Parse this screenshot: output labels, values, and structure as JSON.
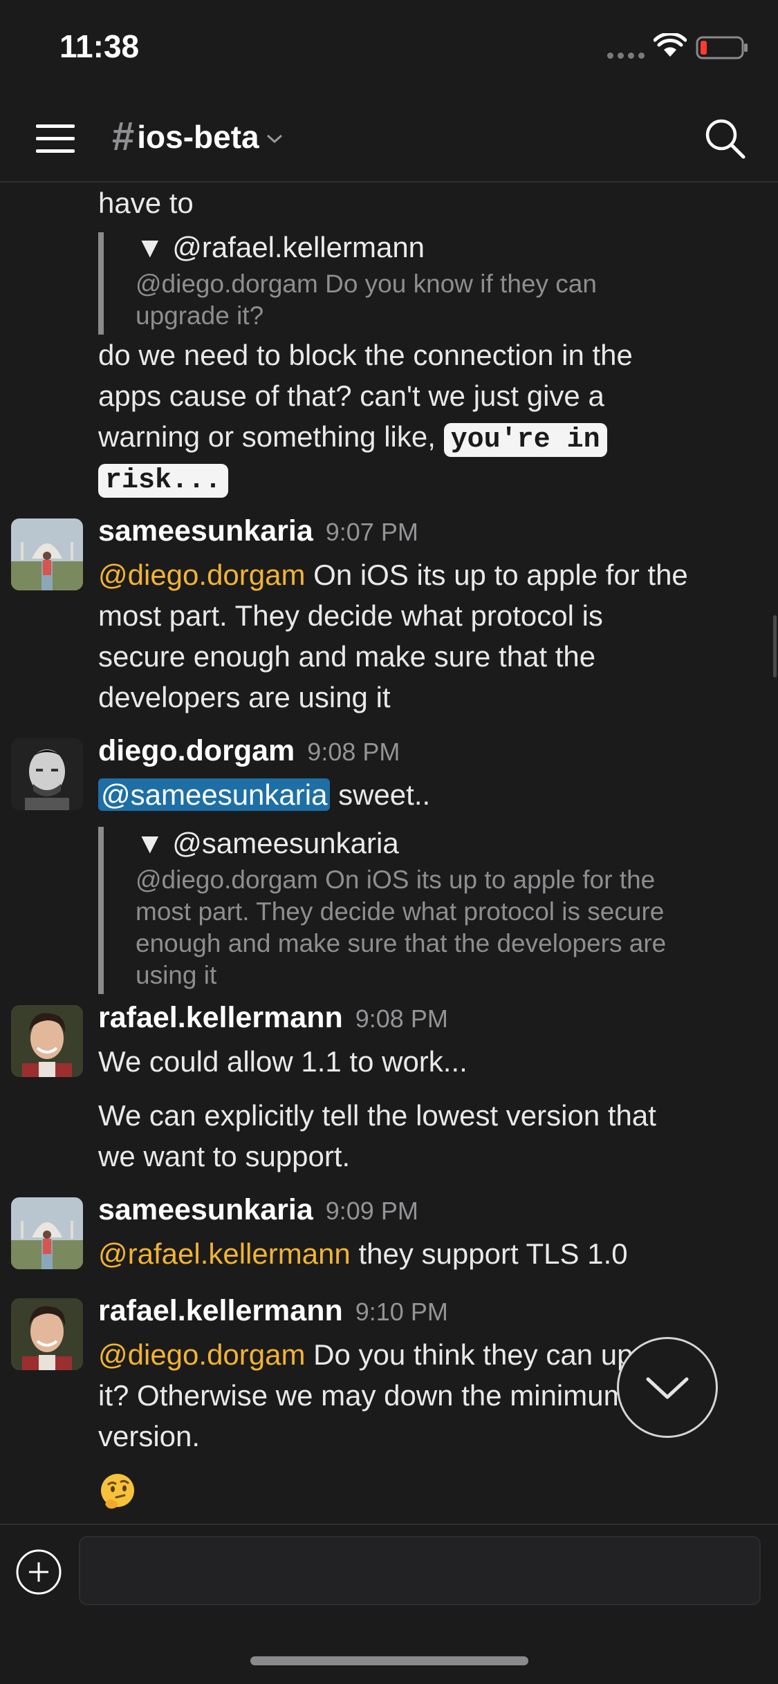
{
  "status_bar": {
    "time": "11:38"
  },
  "header": {
    "hash": "#",
    "channel": "ios-beta"
  },
  "messages": {
    "m0": {
      "cont_line": "have to",
      "quote_head": "▼ @rafael.kellermann",
      "quote_l1": "@diego.dorgam Do you know if they can",
      "quote_l2": "upgrade it?",
      "l1": "do we need to block the connection in the",
      "l2": "apps cause of that? can't we just give a",
      "l3_pre": "warning or something like, ",
      "code1": "you're in",
      "code2": "risk..."
    },
    "m1": {
      "author": "sameesunkaria",
      "time": "9:07 PM",
      "mention": "@diego.dorgam",
      "l1_rest": " On iOS its up to apple for the",
      "l2": "most part. They decide what protocol is",
      "l3": "secure enough and make sure that the",
      "l4": "developers are using it"
    },
    "m2": {
      "author": "diego.dorgam",
      "time": "9:08 PM",
      "mention": "@sameesunkaria",
      "rest": " sweet..",
      "quote_head": "▼ @sameesunkaria",
      "q1": "@diego.dorgam On iOS its up to apple for the",
      "q2": "most part. They decide what protocol is secure",
      "q3": "enough and make sure that the developers are",
      "q4": "using it"
    },
    "m3": {
      "author": "rafael.kellermann",
      "time": "9:08 PM",
      "l1": "We could allow 1.1 to work...",
      "l2": "We can explicitly tell the lowest version that",
      "l3": "we want to support."
    },
    "m4": {
      "author": "sameesunkaria",
      "time": "9:09 PM",
      "mention": "@rafael.kellermann",
      "rest": " they support TLS 1.0"
    },
    "m5": {
      "author": "rafael.kellermann",
      "time": "9:10 PM",
      "mention": "@diego.dorgam",
      "l1_rest": " Do you think they can update",
      "l2": "it? Otherwise we may down the minimum",
      "l3": "version.",
      "emoji": "thinking-face"
    }
  },
  "colors": {
    "background": "#1b1b1c",
    "mention": "#f2b431",
    "mention_highlight": "#1d6fa5",
    "quote_bar": "#8b8b8b"
  },
  "icons": [
    "hamburger-menu-icon",
    "search-icon",
    "chevron-down-icon",
    "wifi-icon",
    "battery-icon",
    "plus-circle-icon",
    "jump-to-bottom-icon"
  ]
}
